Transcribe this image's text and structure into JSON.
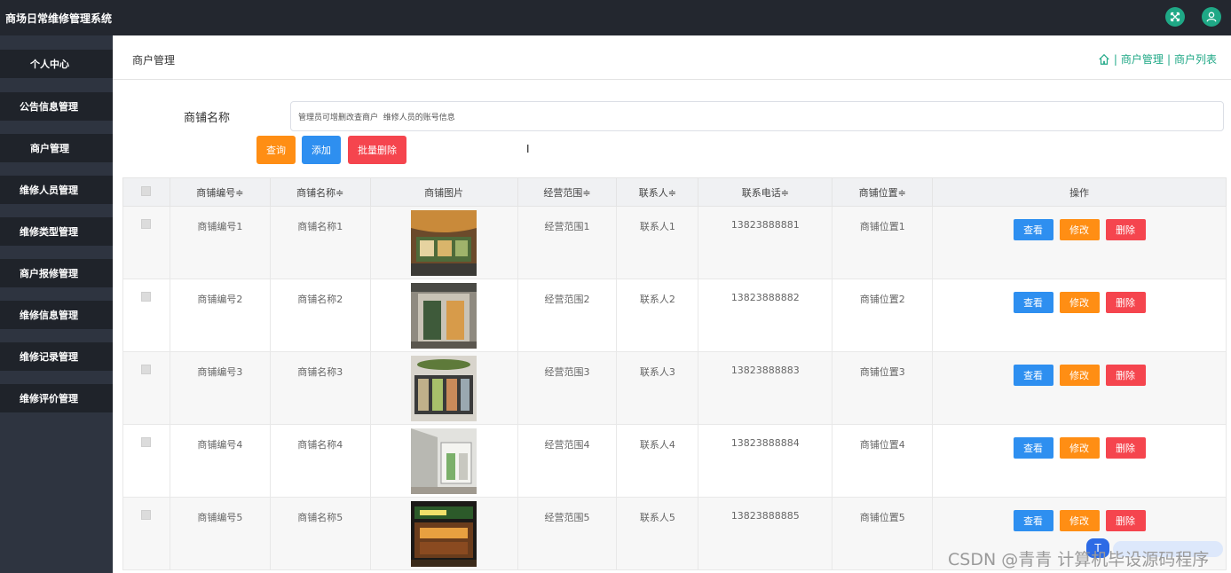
{
  "app": {
    "title": "商场日常维修管理系统"
  },
  "topbar": {
    "fullscreen_icon": "fullscreen-icon",
    "user_icon": "user-icon",
    "accent": "#1fa886"
  },
  "sidebar": {
    "items": [
      {
        "label": "个人中心"
      },
      {
        "label": "公告信息管理"
      },
      {
        "label": "商户管理"
      },
      {
        "label": "维修人员管理"
      },
      {
        "label": "维修类型管理"
      },
      {
        "label": "商户报修管理"
      },
      {
        "label": "维修信息管理"
      },
      {
        "label": "维修记录管理"
      },
      {
        "label": "维修评价管理"
      }
    ]
  },
  "header": {
    "title": "商户管理",
    "breadcrumb": {
      "separator": "|",
      "item1": "商户管理",
      "item2": "商户列表"
    }
  },
  "search": {
    "label": "商铺名称",
    "value": "管理员可增删改查商户  维修人员的账号信息"
  },
  "actions": {
    "query": "查询",
    "add": "添加",
    "batch_delete": "批量删除"
  },
  "table": {
    "headers": [
      "商铺编号≑",
      "商铺名称≑",
      "商铺图片",
      "经营范围≑",
      "联系人≑",
      "联系电话≑",
      "商铺位置≑",
      "操作"
    ],
    "rows": [
      {
        "id": "商铺编号1",
        "name": "商铺名称1",
        "scope": "经营范围1",
        "contact": "联系人1",
        "phone": "13823888881",
        "location": "商铺位置1"
      },
      {
        "id": "商铺编号2",
        "name": "商铺名称2",
        "scope": "经营范围2",
        "contact": "联系人2",
        "phone": "13823888882",
        "location": "商铺位置2"
      },
      {
        "id": "商铺编号3",
        "name": "商铺名称3",
        "scope": "经营范围3",
        "contact": "联系人3",
        "phone": "13823888883",
        "location": "商铺位置3"
      },
      {
        "id": "商铺编号4",
        "name": "商铺名称4",
        "scope": "经营范围4",
        "contact": "联系人4",
        "phone": "13823888884",
        "location": "商铺位置4"
      },
      {
        "id": "商铺编号5",
        "name": "商铺名称5",
        "scope": "经营范围5",
        "contact": "联系人5",
        "phone": "13823888885",
        "location": "商铺位置5"
      }
    ],
    "row_actions": {
      "view": "查看",
      "edit": "修改",
      "delete": "删除"
    }
  },
  "watermark": {
    "text": "CSDN @青青  计算机毕设源码程序"
  },
  "colors": {
    "query": "#ff8e14",
    "add": "#2e8ff0",
    "delete": "#f5454e",
    "sidebar": "#2e3440",
    "topbar": "#23272f"
  }
}
